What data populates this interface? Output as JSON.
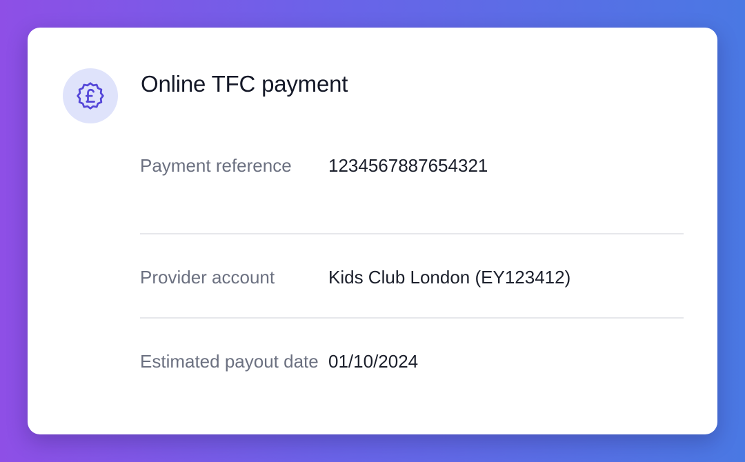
{
  "card": {
    "title": "Online TFC payment",
    "icon": "pound-badge-icon",
    "colors": {
      "accent": "#5446d8",
      "icon_bg": "#dfe3fb",
      "label": "#6b7080",
      "value": "#1b1f2b"
    },
    "rows": [
      {
        "label": "Payment reference",
        "value": "1234567887654321"
      },
      {
        "label": "Provider account",
        "value": "Kids Club London (EY123412)"
      },
      {
        "label": "Estimated payout date",
        "value": "01/10/2024"
      }
    ]
  }
}
